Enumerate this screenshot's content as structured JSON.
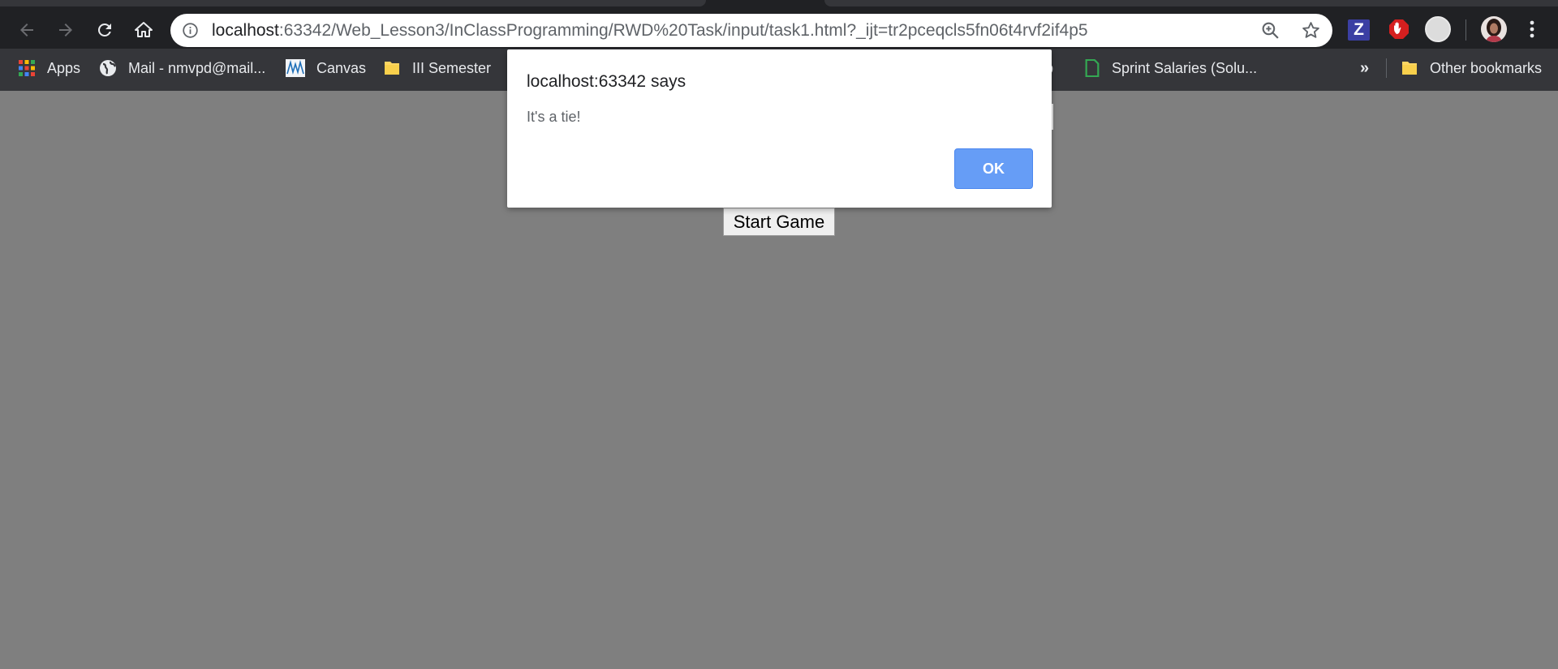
{
  "browser": {
    "url_host": "localhost",
    "url_path": ":63342/Web_Lesson3/InClassProgramming/RWD%20Task/input/task1.html?_ijt=tr2pceqcls5fn06t4rvf2if4p5",
    "extension_z_label": "Z",
    "icons": [
      "back-icon",
      "forward-icon",
      "reload-icon",
      "home-icon",
      "info-icon",
      "zoom-icon",
      "star-icon",
      "menu-dots-icon"
    ]
  },
  "bookmarks": {
    "items": [
      {
        "label": "Apps",
        "icon": "apps-grid-icon"
      },
      {
        "label": "Mail - nmvpd@mail...",
        "icon": "globe-icon"
      },
      {
        "label": "Canvas",
        "icon": "canvas-icon"
      },
      {
        "label": "III Semester",
        "icon": "folder-icon"
      },
      {
        "label": "p",
        "icon": ""
      },
      {
        "label": "Sprint Salaries (Solu...",
        "icon": "sheets-icon"
      }
    ],
    "overflow_label": "»",
    "other_label": "Other bookmarks"
  },
  "page": {
    "start_button_label": "Start Game",
    "background_color": "#7f7f7f"
  },
  "dialog": {
    "title": "localhost:63342 says",
    "message": "It's a tie!",
    "ok_label": "OK",
    "ok_color": "#669df6"
  }
}
